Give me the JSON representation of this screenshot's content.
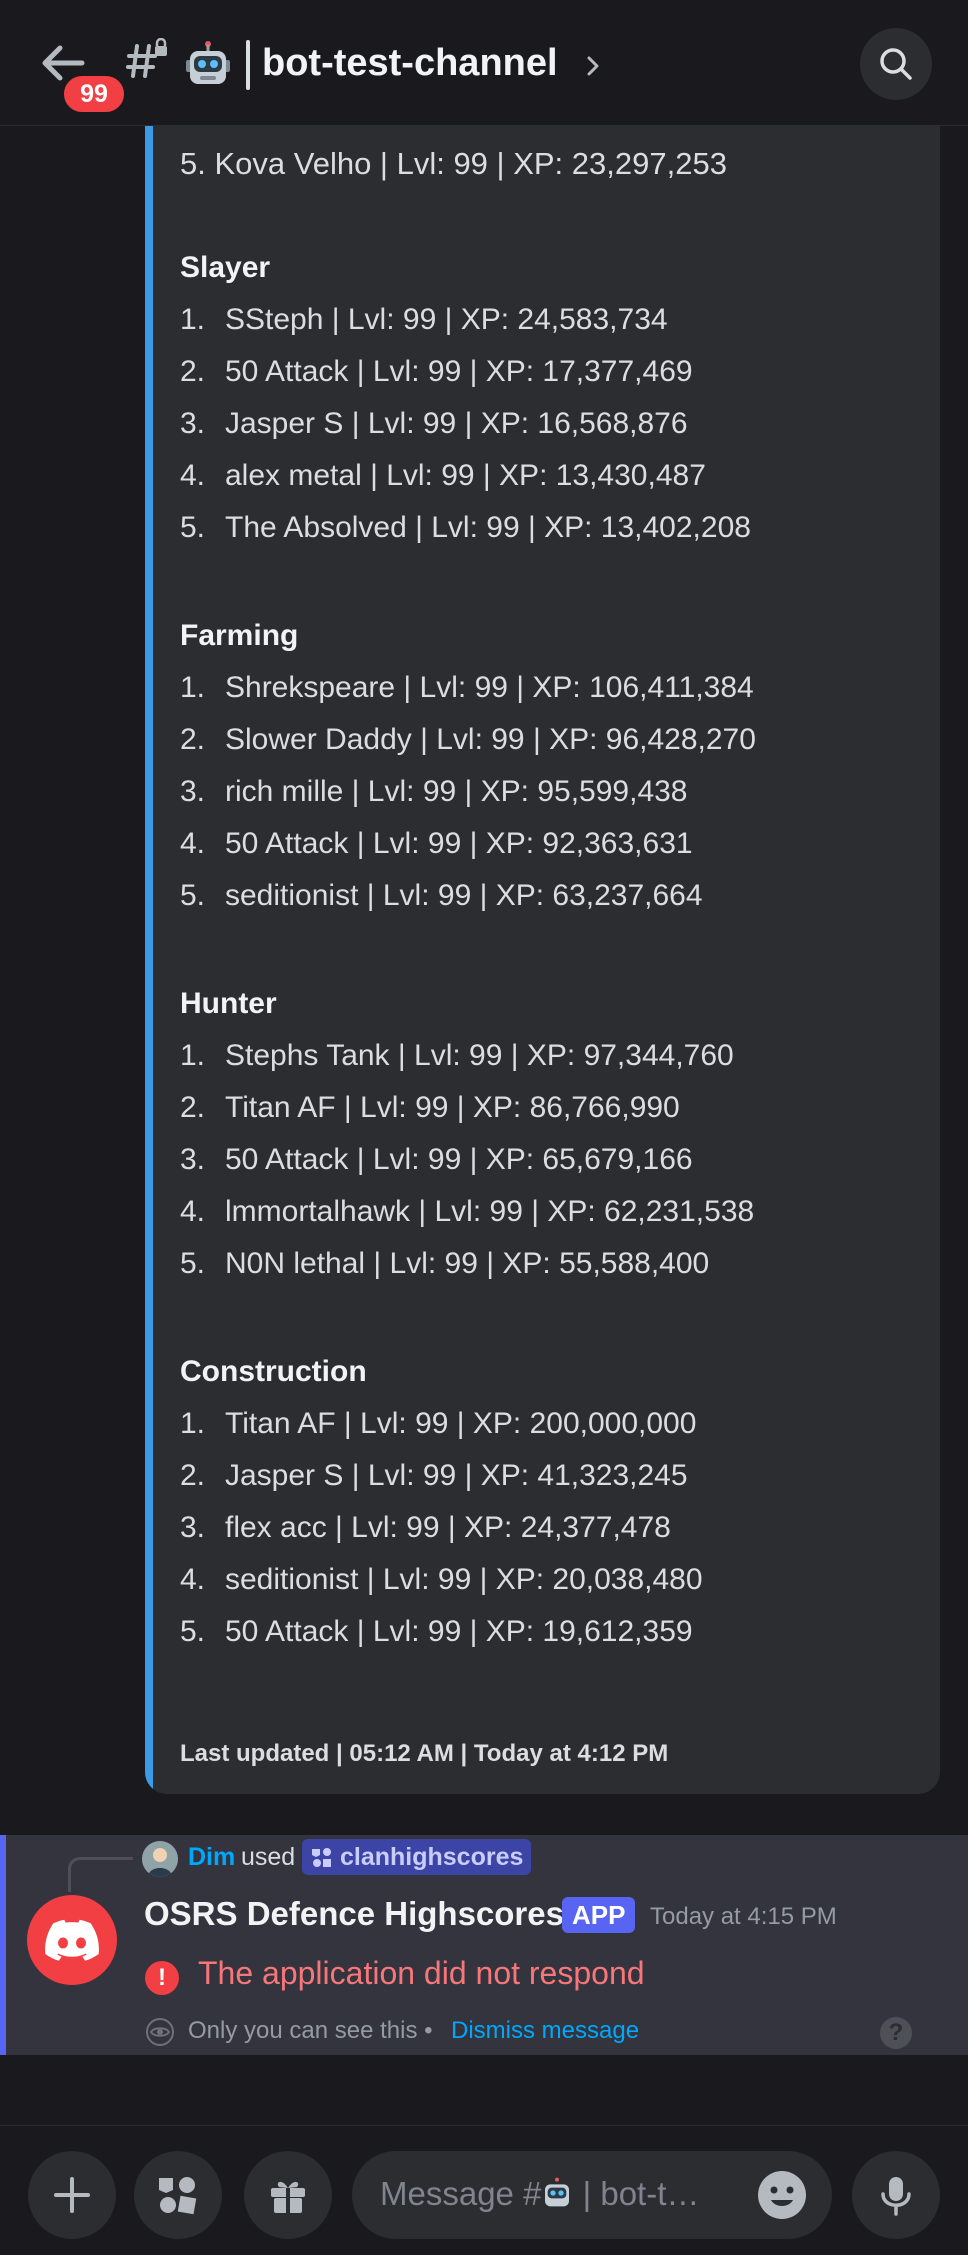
{
  "header": {
    "badge": "99",
    "channel_name": "bot-test-channel"
  },
  "embed": {
    "cut_row": "5.  Kova Velho | Lvl: 99 | XP: 23,297,253",
    "sections": [
      {
        "title": "Slayer",
        "rows": [
          {
            "n": "1.",
            "text": "SSteph | Lvl: 99 | XP: 24,583,734"
          },
          {
            "n": "2.",
            "text": "50 Attack | Lvl: 99 | XP: 17,377,469"
          },
          {
            "n": "3.",
            "text": "Jasper S | Lvl: 99 | XP: 16,568,876"
          },
          {
            "n": "4.",
            "text": "alex metal | Lvl: 99 | XP: 13,430,487"
          },
          {
            "n": "5.",
            "text": "The Absolved | Lvl: 99 | XP: 13,402,208"
          }
        ]
      },
      {
        "title": "Farming",
        "rows": [
          {
            "n": "1.",
            "text": "Shrekspeare | Lvl: 99 | XP: 106,411,384"
          },
          {
            "n": "2.",
            "text": "Slower Daddy | Lvl: 99 | XP: 96,428,270"
          },
          {
            "n": "3.",
            "text": "rich mille | Lvl: 99 | XP: 95,599,438"
          },
          {
            "n": "4.",
            "text": "50 Attack | Lvl: 99 | XP: 92,363,631"
          },
          {
            "n": "5.",
            "text": "seditionist | Lvl: 99 | XP: 63,237,664"
          }
        ]
      },
      {
        "title": "Hunter",
        "rows": [
          {
            "n": "1.",
            "text": "Stephs Tank | Lvl: 99 | XP: 97,344,760"
          },
          {
            "n": "2.",
            "text": "Titan AF | Lvl: 99 | XP: 86,766,990"
          },
          {
            "n": "3.",
            "text": "50 Attack | Lvl: 99 | XP: 65,679,166"
          },
          {
            "n": "4.",
            "text": "lmmortalhawk | Lvl: 99 | XP: 62,231,538"
          },
          {
            "n": "5.",
            "text": "N0N lethal | Lvl: 99 | XP: 55,588,400"
          }
        ]
      },
      {
        "title": "Construction",
        "rows": [
          {
            "n": "1.",
            "text": "Titan AF | Lvl: 99 | XP: 200,000,000"
          },
          {
            "n": "2.",
            "text": "Jasper S | Lvl: 99 | XP: 41,323,245"
          },
          {
            "n": "3.",
            "text": "flex acc | Lvl: 99 | XP: 24,377,478"
          },
          {
            "n": "4.",
            "text": "seditionist | Lvl: 99 | XP: 20,038,480"
          },
          {
            "n": "5.",
            "text": "50 Attack | Lvl: 99 | XP: 19,612,359"
          }
        ]
      }
    ],
    "footer": "Last updated | 05:12 AM | Today at 4:12 PM"
  },
  "message": {
    "reply_user": "Dim",
    "reply_used": "used",
    "command": "clanhighscores",
    "bot_name": "OSRS Defence Highscores",
    "app_tag": "APP",
    "timestamp": "Today at 4:15 PM",
    "error": "The application did not respond",
    "only_you": "Only you can see this •",
    "dismiss": "Dismiss message"
  },
  "composer": {
    "placeholder_prefix": "Message #",
    "placeholder_suffix": "| bot-t…"
  },
  "colors": {
    "accent": "#3a9ce8",
    "brand": "#5865f2",
    "danger": "#f23f43",
    "link": "#00a8fc"
  }
}
